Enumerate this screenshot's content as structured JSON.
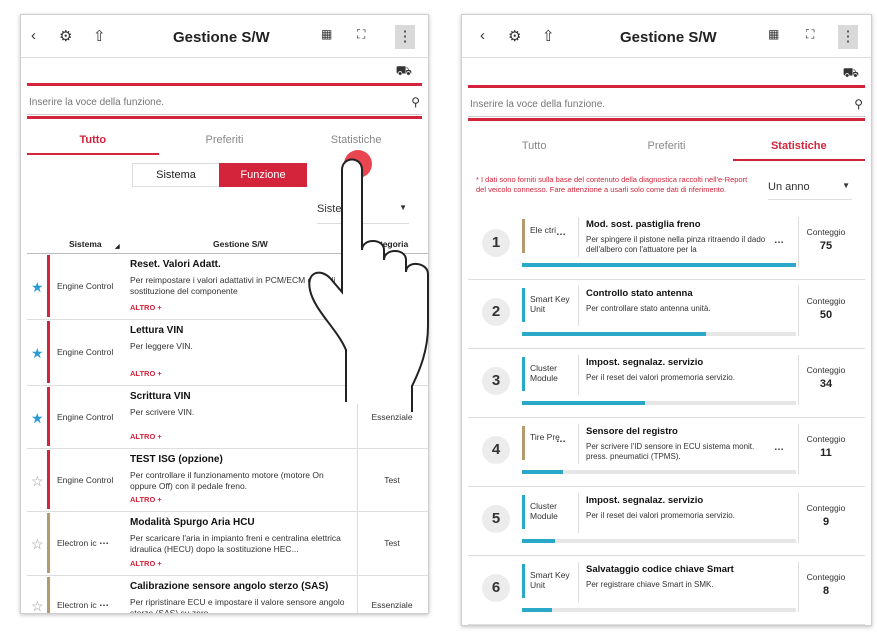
{
  "app": {
    "title": "Gestione S/W",
    "back_icon": "back-arrow-icon",
    "icons": [
      "vci-settings-icon",
      "upload-icon",
      "sd-card-icon",
      "fullscreen-icon",
      "kebab-icon",
      "car-search-icon"
    ]
  },
  "search": {
    "placeholder": "Inserire la voce della funzione."
  },
  "tabs": [
    "Tutto",
    "Preferiti",
    "Statistiche"
  ],
  "left": {
    "active_tab": "Tutto",
    "segments": [
      "Sistema",
      "Funzione"
    ],
    "segment_selected": "Funzione",
    "dropdown_value": "Sistema",
    "columns": {
      "system": "Sistema",
      "sw": "Gestione S/W",
      "category": "Categoria"
    },
    "more_label": "ALTRO +",
    "rows": [
      {
        "fav": true,
        "system": "Engine Control",
        "title": "Reset. Valori Adatt.",
        "desc": "Per reimpostare i valori adattativi in PCM/ECM dopo di sostituzione del componente",
        "category": ""
      },
      {
        "fav": true,
        "system": "Engine Control",
        "title": "Lettura VIN",
        "desc": "Per leggere VIN.",
        "category": ""
      },
      {
        "fav": true,
        "system": "Engine Control",
        "title": "Scrittura VIN",
        "desc": "Per scrivere VIN.",
        "category": "Essenziale"
      },
      {
        "fav": false,
        "system": "Engine Control",
        "title": "TEST ISG (opzione)",
        "desc": "Per controllare il funzionamento motore (motore On oppure Off) con il pedale freno.",
        "category": "Test"
      },
      {
        "fav": false,
        "system": "Electron ic",
        "title": "Modalità Spurgo Aria HCU",
        "desc": "Per scaricare l'aria in impianto freni e centralina elettrica idraulica (HECU) dopo la sostituzione HEC...",
        "category": "Test"
      },
      {
        "fav": false,
        "system": "Electron ic",
        "title": "Calibrazione sensore angolo sterzo (SAS)",
        "desc": "Per ripristinare ECU e impostare il valore sensore angolo sterzo (SAS) su zero",
        "category": "Essenziale"
      }
    ]
  },
  "right": {
    "active_tab": "Statistiche",
    "note": "* I dati sono forniti sulla base del contenuto della diagnostica raccolti nell'e-Report del veicolo connesso. Fare attenzione a usarli solo come dati di riferimento.",
    "period": "Un anno",
    "count_label": "Conteggio",
    "stats": [
      {
        "rank": "1",
        "system": "Ele ctri",
        "title": "Mod. sost. pastiglia freno",
        "desc": "Per spingere il pistone nella pinza ritraendo il dado dell'albero con l'attuatore per la",
        "count": "75",
        "progress": 1.0,
        "bar_color": "#b49a6e",
        "has_more": true
      },
      {
        "rank": "2",
        "system": "Smart Key Unit",
        "title": "Controllo stato antenna",
        "desc": "Per controllare stato antenna unità.",
        "count": "50",
        "progress": 0.67,
        "bar_color": "#2aa8c7",
        "has_more": false
      },
      {
        "rank": "3",
        "system": "Cluster Module",
        "title": "Impost. segnalaz. servizio",
        "desc": "Per il reset dei valori promemoria servizio.",
        "count": "34",
        "progress": 0.45,
        "bar_color": "#2aa8c7",
        "has_more": false
      },
      {
        "rank": "4",
        "system": "Tire Pre",
        "title": "Sensore del registro",
        "desc": "Per scrivere l'ID sensore in ECU sistema monit. press. pneumatici (TPMS).",
        "count": "11",
        "progress": 0.15,
        "bar_color": "#b49a6e",
        "has_more": true
      },
      {
        "rank": "5",
        "system": "Cluster Module",
        "title": "Impost. segnalaz. servizio",
        "desc": "Per il reset dei valori promemoria servizio.",
        "count": "9",
        "progress": 0.12,
        "bar_color": "#2aa8c7",
        "has_more": false
      },
      {
        "rank": "6",
        "system": "Smart Key Unit",
        "title": "Salvataggio codice chiave Smart",
        "desc": "Per registrare chiave Smart in SMK.",
        "count": "8",
        "progress": 0.11,
        "bar_color": "#2aa8c7",
        "has_more": false
      }
    ]
  }
}
